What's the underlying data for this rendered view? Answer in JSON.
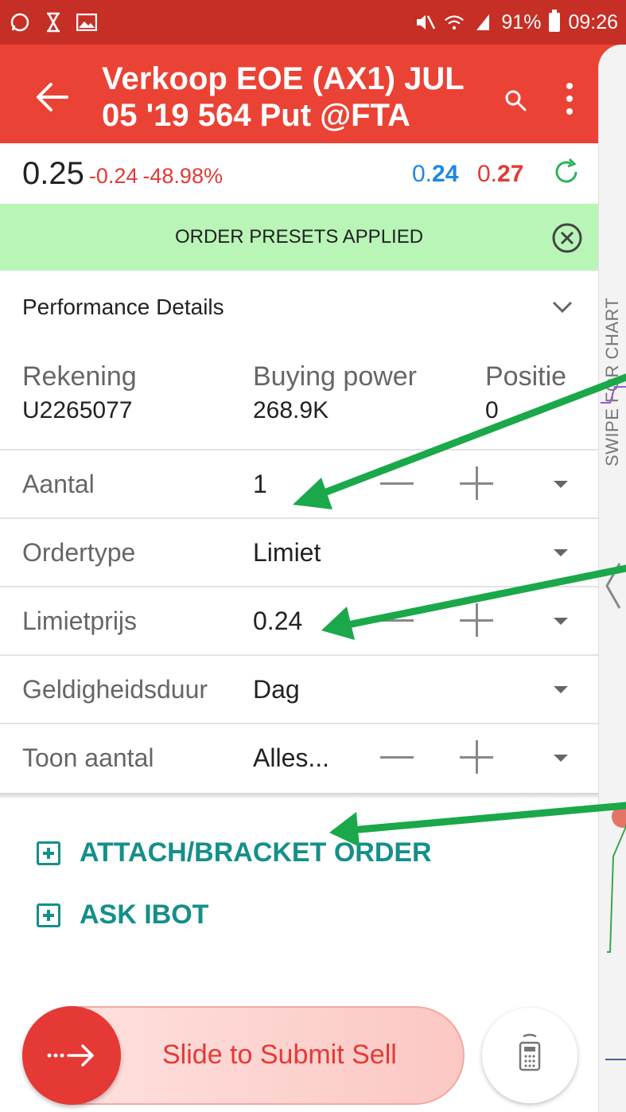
{
  "status_bar": {
    "battery": "91%",
    "time": "09:26",
    "left_icons": [
      "whatsapp-icon",
      "hourglass-icon",
      "image-icon"
    ],
    "right_icons": [
      "mute-icon",
      "wifi-icon",
      "signal-icon",
      "battery-icon"
    ]
  },
  "app_bar": {
    "title_line1": "Verkoop EOE (AX1) JUL",
    "title_line2": "05 '19 564 Put @FTA",
    "color": "#ea4335"
  },
  "quote": {
    "last": "0.25",
    "change": "-0.24",
    "change_pct": "-48.98%",
    "bid_prefix": "0.",
    "bid_bold": "24",
    "ask_prefix": "0.",
    "ask_bold": "27"
  },
  "banner": {
    "text": "ORDER PRESETS APPLIED"
  },
  "performance": {
    "label": "Performance Details"
  },
  "account": {
    "rekening_label": "Rekening",
    "rekening_value": "U2265077",
    "buying_power_label": "Buying power",
    "buying_power_value": "268.9K",
    "positie_label": "Positie",
    "positie_value": "0"
  },
  "form": {
    "aantal_label": "Aantal",
    "aantal_value": "1",
    "ordertype_label": "Ordertype",
    "ordertype_value": "Limiet",
    "limietprijs_label": "Limietprijs",
    "limietprijs_value": "0.24",
    "geldigheid_label": "Geldigheidsduur",
    "geldigheid_value": "Dag",
    "toon_label": "Toon aantal",
    "toon_value": "Alles..."
  },
  "actions": {
    "attach": "ATTACH/BRACKET ORDER",
    "ibot": "ASK IBOT",
    "color": "#158f8a"
  },
  "slider": {
    "label": "Slide to Submit Sell"
  },
  "side_panel": {
    "label": "SWIPE FOR CHART"
  },
  "annotation_color": "#1aa84a"
}
